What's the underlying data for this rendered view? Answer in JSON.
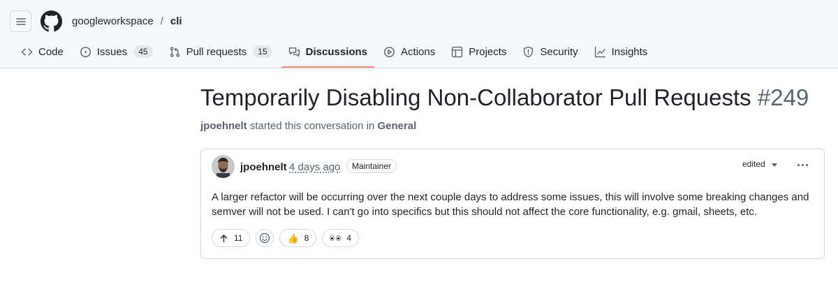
{
  "header": {
    "owner": "googleworkspace",
    "separator": "/",
    "repo": "cli"
  },
  "tabs": [
    {
      "label": "Code",
      "icon": "code-icon"
    },
    {
      "label": "Issues",
      "icon": "issue-opened-icon",
      "count": "45"
    },
    {
      "label": "Pull requests",
      "icon": "git-pull-request-icon",
      "count": "15"
    },
    {
      "label": "Discussions",
      "icon": "comment-discussion-icon",
      "selected": true
    },
    {
      "label": "Actions",
      "icon": "play-icon"
    },
    {
      "label": "Projects",
      "icon": "table-icon"
    },
    {
      "label": "Security",
      "icon": "shield-icon"
    },
    {
      "label": "Insights",
      "icon": "graph-icon"
    }
  ],
  "discussion": {
    "title": "Temporarily Disabling Non-Collaborator Pull Requests",
    "number": "#249",
    "started_by": "jpoehnelt",
    "started_text": "started this conversation in",
    "category": "General"
  },
  "post": {
    "author": "jpoehnelt",
    "time": "4 days ago",
    "badge": "Maintainer",
    "edited_label": "edited",
    "body": "A larger refactor will be occurring over the next couple days to address some issues, this will involve some breaking changes and semver will not be used. I can't go into specifics but this should not affect the core functionality, e.g. gmail, sheets, etc.",
    "reactions": {
      "upvote_count": "11",
      "thumbs_up_emoji": "👍",
      "thumbs_up_count": "8",
      "eyes_count": "4"
    }
  },
  "colors": {
    "tab_underline": "#fd8c73",
    "muted_text": "#59636e",
    "border": "#d1d9e0"
  }
}
